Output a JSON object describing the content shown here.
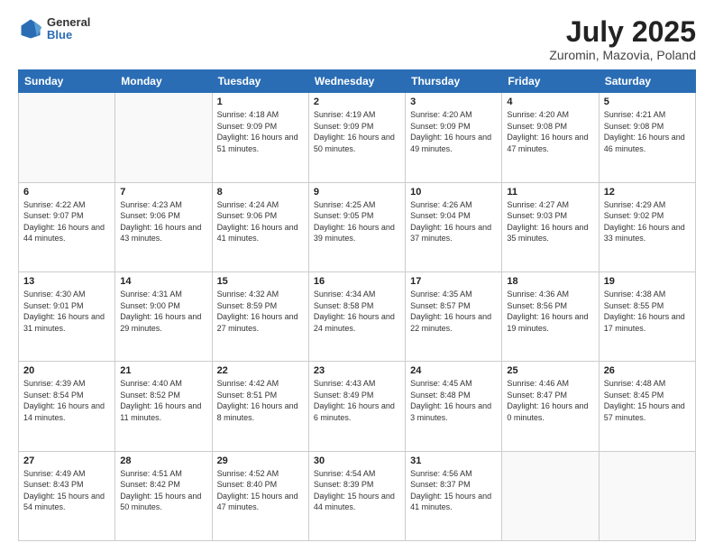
{
  "header": {
    "logo_general": "General",
    "logo_blue": "Blue",
    "title": "July 2025",
    "subtitle": "Zuromin, Mazovia, Poland"
  },
  "days_of_week": [
    "Sunday",
    "Monday",
    "Tuesday",
    "Wednesday",
    "Thursday",
    "Friday",
    "Saturday"
  ],
  "weeks": [
    [
      {
        "day": "",
        "empty": true
      },
      {
        "day": "",
        "empty": true
      },
      {
        "day": "1",
        "sunrise": "Sunrise: 4:18 AM",
        "sunset": "Sunset: 9:09 PM",
        "daylight": "Daylight: 16 hours and 51 minutes."
      },
      {
        "day": "2",
        "sunrise": "Sunrise: 4:19 AM",
        "sunset": "Sunset: 9:09 PM",
        "daylight": "Daylight: 16 hours and 50 minutes."
      },
      {
        "day": "3",
        "sunrise": "Sunrise: 4:20 AM",
        "sunset": "Sunset: 9:09 PM",
        "daylight": "Daylight: 16 hours and 49 minutes."
      },
      {
        "day": "4",
        "sunrise": "Sunrise: 4:20 AM",
        "sunset": "Sunset: 9:08 PM",
        "daylight": "Daylight: 16 hours and 47 minutes."
      },
      {
        "day": "5",
        "sunrise": "Sunrise: 4:21 AM",
        "sunset": "Sunset: 9:08 PM",
        "daylight": "Daylight: 16 hours and 46 minutes."
      }
    ],
    [
      {
        "day": "6",
        "sunrise": "Sunrise: 4:22 AM",
        "sunset": "Sunset: 9:07 PM",
        "daylight": "Daylight: 16 hours and 44 minutes."
      },
      {
        "day": "7",
        "sunrise": "Sunrise: 4:23 AM",
        "sunset": "Sunset: 9:06 PM",
        "daylight": "Daylight: 16 hours and 43 minutes."
      },
      {
        "day": "8",
        "sunrise": "Sunrise: 4:24 AM",
        "sunset": "Sunset: 9:06 PM",
        "daylight": "Daylight: 16 hours and 41 minutes."
      },
      {
        "day": "9",
        "sunrise": "Sunrise: 4:25 AM",
        "sunset": "Sunset: 9:05 PM",
        "daylight": "Daylight: 16 hours and 39 minutes."
      },
      {
        "day": "10",
        "sunrise": "Sunrise: 4:26 AM",
        "sunset": "Sunset: 9:04 PM",
        "daylight": "Daylight: 16 hours and 37 minutes."
      },
      {
        "day": "11",
        "sunrise": "Sunrise: 4:27 AM",
        "sunset": "Sunset: 9:03 PM",
        "daylight": "Daylight: 16 hours and 35 minutes."
      },
      {
        "day": "12",
        "sunrise": "Sunrise: 4:29 AM",
        "sunset": "Sunset: 9:02 PM",
        "daylight": "Daylight: 16 hours and 33 minutes."
      }
    ],
    [
      {
        "day": "13",
        "sunrise": "Sunrise: 4:30 AM",
        "sunset": "Sunset: 9:01 PM",
        "daylight": "Daylight: 16 hours and 31 minutes."
      },
      {
        "day": "14",
        "sunrise": "Sunrise: 4:31 AM",
        "sunset": "Sunset: 9:00 PM",
        "daylight": "Daylight: 16 hours and 29 minutes."
      },
      {
        "day": "15",
        "sunrise": "Sunrise: 4:32 AM",
        "sunset": "Sunset: 8:59 PM",
        "daylight": "Daylight: 16 hours and 27 minutes."
      },
      {
        "day": "16",
        "sunrise": "Sunrise: 4:34 AM",
        "sunset": "Sunset: 8:58 PM",
        "daylight": "Daylight: 16 hours and 24 minutes."
      },
      {
        "day": "17",
        "sunrise": "Sunrise: 4:35 AM",
        "sunset": "Sunset: 8:57 PM",
        "daylight": "Daylight: 16 hours and 22 minutes."
      },
      {
        "day": "18",
        "sunrise": "Sunrise: 4:36 AM",
        "sunset": "Sunset: 8:56 PM",
        "daylight": "Daylight: 16 hours and 19 minutes."
      },
      {
        "day": "19",
        "sunrise": "Sunrise: 4:38 AM",
        "sunset": "Sunset: 8:55 PM",
        "daylight": "Daylight: 16 hours and 17 minutes."
      }
    ],
    [
      {
        "day": "20",
        "sunrise": "Sunrise: 4:39 AM",
        "sunset": "Sunset: 8:54 PM",
        "daylight": "Daylight: 16 hours and 14 minutes."
      },
      {
        "day": "21",
        "sunrise": "Sunrise: 4:40 AM",
        "sunset": "Sunset: 8:52 PM",
        "daylight": "Daylight: 16 hours and 11 minutes."
      },
      {
        "day": "22",
        "sunrise": "Sunrise: 4:42 AM",
        "sunset": "Sunset: 8:51 PM",
        "daylight": "Daylight: 16 hours and 8 minutes."
      },
      {
        "day": "23",
        "sunrise": "Sunrise: 4:43 AM",
        "sunset": "Sunset: 8:49 PM",
        "daylight": "Daylight: 16 hours and 6 minutes."
      },
      {
        "day": "24",
        "sunrise": "Sunrise: 4:45 AM",
        "sunset": "Sunset: 8:48 PM",
        "daylight": "Daylight: 16 hours and 3 minutes."
      },
      {
        "day": "25",
        "sunrise": "Sunrise: 4:46 AM",
        "sunset": "Sunset: 8:47 PM",
        "daylight": "Daylight: 16 hours and 0 minutes."
      },
      {
        "day": "26",
        "sunrise": "Sunrise: 4:48 AM",
        "sunset": "Sunset: 8:45 PM",
        "daylight": "Daylight: 15 hours and 57 minutes."
      }
    ],
    [
      {
        "day": "27",
        "sunrise": "Sunrise: 4:49 AM",
        "sunset": "Sunset: 8:43 PM",
        "daylight": "Daylight: 15 hours and 54 minutes."
      },
      {
        "day": "28",
        "sunrise": "Sunrise: 4:51 AM",
        "sunset": "Sunset: 8:42 PM",
        "daylight": "Daylight: 15 hours and 50 minutes."
      },
      {
        "day": "29",
        "sunrise": "Sunrise: 4:52 AM",
        "sunset": "Sunset: 8:40 PM",
        "daylight": "Daylight: 15 hours and 47 minutes."
      },
      {
        "day": "30",
        "sunrise": "Sunrise: 4:54 AM",
        "sunset": "Sunset: 8:39 PM",
        "daylight": "Daylight: 15 hours and 44 minutes."
      },
      {
        "day": "31",
        "sunrise": "Sunrise: 4:56 AM",
        "sunset": "Sunset: 8:37 PM",
        "daylight": "Daylight: 15 hours and 41 minutes."
      },
      {
        "day": "",
        "empty": true
      },
      {
        "day": "",
        "empty": true
      }
    ]
  ]
}
